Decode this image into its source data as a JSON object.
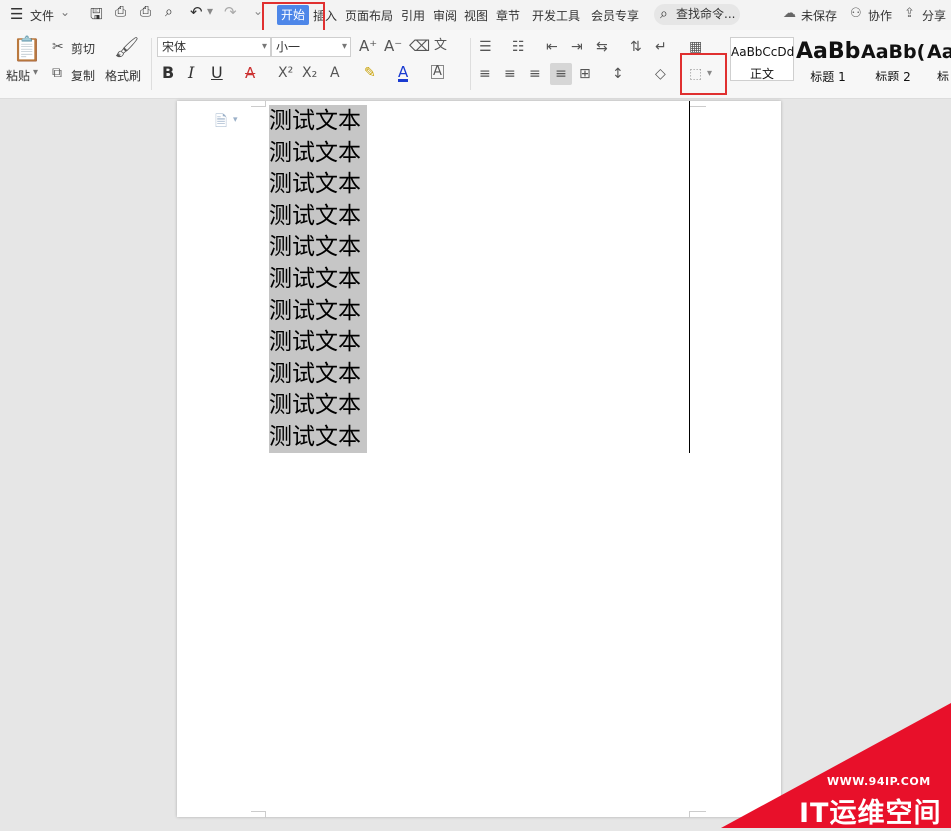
{
  "menubar": {
    "file": "文件",
    "tabs": [
      "开始",
      "插入",
      "页面布局",
      "引用",
      "审阅",
      "视图",
      "章节",
      "开发工具",
      "会员专享"
    ],
    "search_placeholder": "查找命令...",
    "unsaved": "未保存",
    "collab": "协作",
    "share": "分享"
  },
  "ribbon": {
    "paste": "粘贴",
    "cut": "剪切",
    "copy": "复制",
    "format_painter": "格式刷",
    "font_name": "宋体",
    "font_size": "小一",
    "styles": [
      {
        "preview": "AaBbCcDd",
        "name": "正文"
      },
      {
        "preview": "AaBb",
        "name": "标题 1"
      },
      {
        "preview": "AaBb(",
        "name": "标题 2"
      },
      {
        "preview": "Aa",
        "name": "标"
      }
    ]
  },
  "document": {
    "lines": [
      "测试文本",
      "测试文本",
      "测试文本",
      "测试文本",
      "测试文本",
      "测试文本",
      "测试文本",
      "测试文本",
      "测试文本",
      "测试文本",
      "测试文本"
    ]
  },
  "watermark": {
    "url": "WWW.94IP.COM",
    "text": "IT运维空间"
  },
  "colors": {
    "active_tab": "#4d86e8",
    "highlight_box": "#e03030",
    "selection": "#c6c6c6",
    "watermark_red": "#e8102a"
  }
}
